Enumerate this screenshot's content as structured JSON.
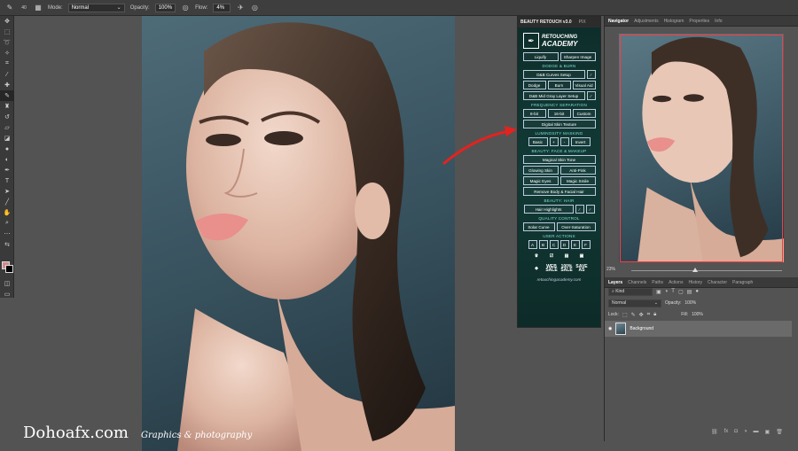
{
  "options_bar": {
    "brush_size": "40",
    "mode_label": "Mode:",
    "mode_value": "Normal",
    "opacity_label": "Opacity:",
    "opacity_value": "100%",
    "flow_label": "Flow:",
    "flow_value": "4%"
  },
  "beauty_panel": {
    "tab_active": "BEAUTY RETOUCH v3.0",
    "tab_inactive": "PIX",
    "logo_line1": "RETOUCHING",
    "logo_line2": "ACADEMY",
    "liquify": "Liquify",
    "sharpen": "Sharpen Image",
    "h_dodge_burn": "DODGE & BURN",
    "db_curves": "D&B Curves Setup",
    "dodge": "Dodge",
    "burn": "Burn",
    "visual_aid": "Visual Aid",
    "db_midgray": "D&B Mid Gray Layer Setup",
    "h_freq": "FREQUENCY SEPARATION",
    "bit8": "8-bit",
    "bit16": "16-bit",
    "custom": "Custom",
    "digital_skin": "Digital Skin Texture",
    "h_lum": "LUMINOSITY MASKING",
    "basic": "Basic",
    "plus": "+",
    "minus": "-",
    "invert": "Invert",
    "h_face": "BEAUTY: FACE & MAKEUP",
    "magical_skin": "Magical Skin Tone",
    "glowing_skin": "Glowing Skin",
    "anti_pink": "Anti-Pink",
    "magic_eyes": "Magic Eyes",
    "magic_smile": "Magic Smile",
    "remove_body_hair": "Remove Body & Facial Hair",
    "h_hair": "BEAUTY: HAIR",
    "hair_highlights": "Hair Highlights",
    "h_qc": "QUALITY CONTROL",
    "solar_curve": "Solar Curve",
    "over_saturation": "Over-Saturation",
    "h_user": "USER ACTIONS",
    "user_actions": [
      "A",
      "B",
      "C",
      "D",
      "E",
      "F"
    ],
    "web_sale": "WEB\nSALE",
    "pct_sale": "100%\nSALE",
    "save_as": "SAVE\nAS",
    "footer": "retouchingacademy.com"
  },
  "navigator": {
    "tabs": [
      "Navigator",
      "Adjustments",
      "Histogram",
      "Properties",
      "Info"
    ],
    "zoom": "23%"
  },
  "layers": {
    "tabs": [
      "Layers",
      "Channels",
      "Paths",
      "Actions",
      "History",
      "Character",
      "Paragraph"
    ],
    "kind_label": "Kind",
    "blend_mode": "Normal",
    "opacity_label": "Opacity:",
    "opacity_value": "100%",
    "lock_label": "Lock:",
    "fill_label": "Fill:",
    "fill_value": "100%",
    "layer_name": "Background"
  },
  "watermark": {
    "site": "Dohoafx.com",
    "tagline": "Graphics & photography"
  },
  "colors": {
    "foreground": "#d18a8a",
    "background": "#000000",
    "accent": "#ff3b3b"
  }
}
